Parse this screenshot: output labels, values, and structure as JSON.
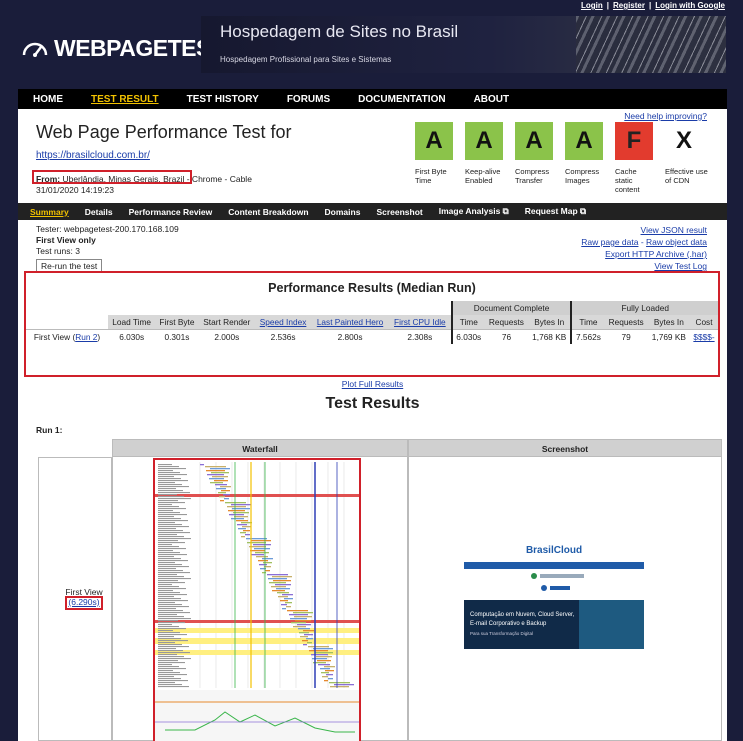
{
  "top_links": {
    "login": "Login",
    "register": "Register",
    "google": "Login with Google",
    "sep": "|"
  },
  "logo": {
    "text": "WEBPAGETEST"
  },
  "banner": {
    "title": "Hospedagem de Sites no Brasil",
    "subtitle": "Hospedagem Profissional para Sites e Sistemas"
  },
  "nav": [
    {
      "label": "HOME",
      "active": false
    },
    {
      "label": "TEST RESULT",
      "active": true
    },
    {
      "label": "TEST HISTORY",
      "active": false
    },
    {
      "label": "FORUMS",
      "active": false
    },
    {
      "label": "DOCUMENTATION",
      "active": false
    },
    {
      "label": "ABOUT",
      "active": false
    }
  ],
  "header": {
    "title": "Web Page Performance Test for",
    "url": "https://brasilcloud.com.br/",
    "from_label": "From:",
    "from_location": "Uberlândia, Minas Gerais, Brazil",
    "from_suffix": "- Chrome - Cable",
    "date": "31/01/2020 14:19:23",
    "help": "Need help improving?"
  },
  "grades": [
    {
      "grade": "A",
      "label": "First Byte Time",
      "style": "a"
    },
    {
      "grade": "A",
      "label": "Keep-alive Enabled",
      "style": "a"
    },
    {
      "grade": "A",
      "label": "Compress Transfer",
      "style": "a"
    },
    {
      "grade": "A",
      "label": "Compress Images",
      "style": "a"
    },
    {
      "grade": "F",
      "label": "Cache static content",
      "style": "f"
    },
    {
      "grade": "X",
      "label": "Effective use of CDN",
      "style": "x"
    }
  ],
  "tabs": [
    {
      "label": "Summary",
      "active": true
    },
    {
      "label": "Details",
      "active": false
    },
    {
      "label": "Performance Review",
      "active": false
    },
    {
      "label": "Content Breakdown",
      "active": false
    },
    {
      "label": "Domains",
      "active": false
    },
    {
      "label": "Screenshot",
      "active": false
    },
    {
      "label": "Image Analysis ⧉",
      "active": false
    },
    {
      "label": "Request Map ⧉",
      "active": false
    }
  ],
  "tester": {
    "line1": "Tester: webpagetest-200.170.168.109",
    "line2": "First View only",
    "line3": "Test runs: 3",
    "rerun": "Re-run the test"
  },
  "right_links": {
    "json": "View JSON result",
    "raw_page": "Raw page data",
    "dash": "-",
    "raw_object": "Raw object data",
    "export": "Export HTTP Archive (.har)",
    "log": "View Test Log"
  },
  "perf": {
    "title": "Performance Results (Median Run)",
    "group_doc": "Document Complete",
    "group_full": "Fully Loaded",
    "headers": [
      "Load Time",
      "First Byte",
      "Start Render",
      "Speed Index",
      "Last Painted Hero",
      "First CPU Idle",
      "Time",
      "Requests",
      "Bytes In",
      "Time",
      "Requests",
      "Bytes In",
      "Cost"
    ],
    "row_label": "First View (",
    "row_link": "Run 2",
    "row_close": ")",
    "values": [
      "6.030s",
      "0.301s",
      "2.000s",
      "2.536s",
      "2.800s",
      "2.308s",
      "6.030s",
      "76",
      "1,768 KB",
      "7.562s",
      "79",
      "1,769 KB",
      "$$$$-"
    ]
  },
  "plot_full": "Plot Full Results",
  "test_results": {
    "title": "Test Results",
    "run": "Run 1:",
    "col_waterfall": "Waterfall",
    "col_screenshot": "Screenshot",
    "first_view": "First View",
    "first_view_time": "(6.290s)"
  },
  "screenshot": {
    "brand": "BrasilCloud",
    "hero_line1": "Computação em Nuvem, Cloud Server,",
    "hero_line2": "E-mail Corporativo e Backup",
    "hero_line3": "Para sua Transformação Digital"
  }
}
